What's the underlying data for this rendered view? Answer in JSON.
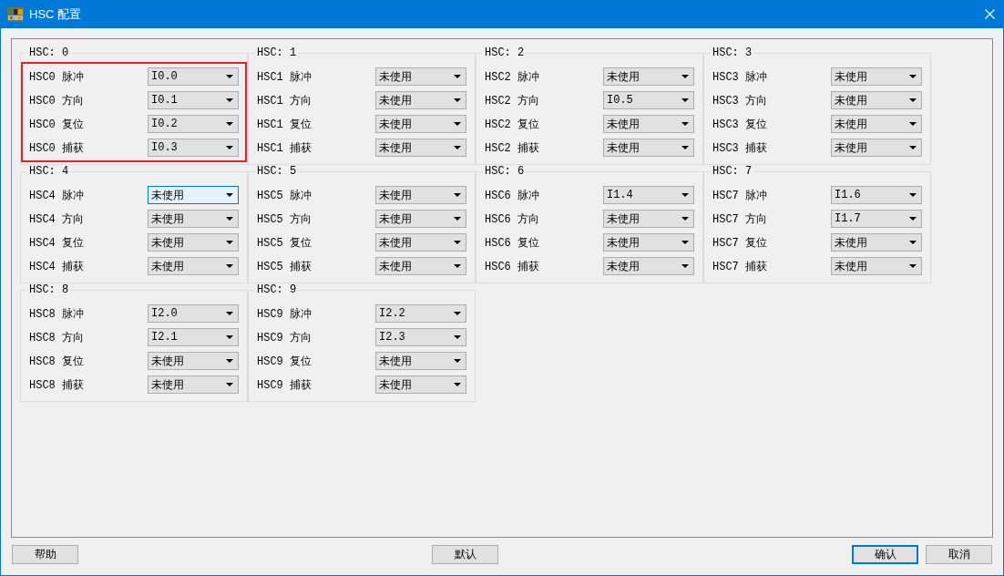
{
  "window": {
    "title": "HSC 配置"
  },
  "groups": [
    {
      "title": "HSC: 0",
      "highlighted": true,
      "fields": [
        {
          "label": "HSC0 脉冲",
          "value": "I0.0",
          "focused": false
        },
        {
          "label": "HSC0 方向",
          "value": "I0.1",
          "focused": false
        },
        {
          "label": "HSC0 复位",
          "value": "I0.2",
          "focused": false
        },
        {
          "label": "HSC0 捕获",
          "value": "I0.3",
          "focused": false
        }
      ]
    },
    {
      "title": "HSC: 1",
      "highlighted": false,
      "fields": [
        {
          "label": "HSC1 脉冲",
          "value": "未使用",
          "focused": false
        },
        {
          "label": "HSC1 方向",
          "value": "未使用",
          "focused": false
        },
        {
          "label": "HSC1 复位",
          "value": "未使用",
          "focused": false
        },
        {
          "label": "HSC1 捕获",
          "value": "未使用",
          "focused": false
        }
      ]
    },
    {
      "title": "HSC: 2",
      "highlighted": false,
      "fields": [
        {
          "label": "HSC2 脉冲",
          "value": "未使用",
          "focused": false
        },
        {
          "label": "HSC2 方向",
          "value": "I0.5",
          "focused": false
        },
        {
          "label": "HSC2 复位",
          "value": "未使用",
          "focused": false
        },
        {
          "label": "HSC2 捕获",
          "value": "未使用",
          "focused": false
        }
      ]
    },
    {
      "title": "HSC: 3",
      "highlighted": false,
      "fields": [
        {
          "label": "HSC3 脉冲",
          "value": "未使用",
          "focused": false
        },
        {
          "label": "HSC3 方向",
          "value": "未使用",
          "focused": false
        },
        {
          "label": "HSC3 复位",
          "value": "未使用",
          "focused": false
        },
        {
          "label": "HSC3 捕获",
          "value": "未使用",
          "focused": false
        }
      ]
    },
    {
      "title": "HSC: 4",
      "highlighted": false,
      "fields": [
        {
          "label": "HSC4 脉冲",
          "value": "未使用",
          "focused": true
        },
        {
          "label": "HSC4 方向",
          "value": "未使用",
          "focused": false
        },
        {
          "label": "HSC4 复位",
          "value": "未使用",
          "focused": false
        },
        {
          "label": "HSC4 捕获",
          "value": "未使用",
          "focused": false
        }
      ]
    },
    {
      "title": "HSC: 5",
      "highlighted": false,
      "fields": [
        {
          "label": "HSC5 脉冲",
          "value": "未使用",
          "focused": false
        },
        {
          "label": "HSC5 方向",
          "value": "未使用",
          "focused": false
        },
        {
          "label": "HSC5 复位",
          "value": "未使用",
          "focused": false
        },
        {
          "label": "HSC5 捕获",
          "value": "未使用",
          "focused": false
        }
      ]
    },
    {
      "title": "HSC: 6",
      "highlighted": false,
      "fields": [
        {
          "label": "HSC6 脉冲",
          "value": "I1.4",
          "focused": false
        },
        {
          "label": "HSC6 方向",
          "value": "未使用",
          "focused": false
        },
        {
          "label": "HSC6 复位",
          "value": "未使用",
          "focused": false
        },
        {
          "label": "HSC6 捕获",
          "value": "未使用",
          "focused": false
        }
      ]
    },
    {
      "title": "HSC: 7",
      "highlighted": false,
      "fields": [
        {
          "label": "HSC7 脉冲",
          "value": "I1.6",
          "focused": false
        },
        {
          "label": "HSC7 方向",
          "value": "I1.7",
          "focused": false
        },
        {
          "label": "HSC7 复位",
          "value": "未使用",
          "focused": false
        },
        {
          "label": "HSC7 捕获",
          "value": "未使用",
          "focused": false
        }
      ]
    },
    {
      "title": "HSC: 8",
      "highlighted": false,
      "fields": [
        {
          "label": "HSC8 脉冲",
          "value": "I2.0",
          "focused": false
        },
        {
          "label": "HSC8 方向",
          "value": "I2.1",
          "focused": false
        },
        {
          "label": "HSC8 复位",
          "value": "未使用",
          "focused": false
        },
        {
          "label": "HSC8 捕获",
          "value": "未使用",
          "focused": false
        }
      ]
    },
    {
      "title": "HSC: 9",
      "highlighted": false,
      "fields": [
        {
          "label": "HSC9 脉冲",
          "value": "I2.2",
          "focused": false
        },
        {
          "label": "HSC9 方向",
          "value": "I2.3",
          "focused": false
        },
        {
          "label": "HSC9 复位",
          "value": "未使用",
          "focused": false
        },
        {
          "label": "HSC9 捕获",
          "value": "未使用",
          "focused": false
        }
      ]
    }
  ],
  "footer": {
    "left_buttons": [
      {
        "label": "帮助",
        "default": false
      }
    ],
    "center_buttons": [
      {
        "label": "默认",
        "default": false
      }
    ],
    "right_buttons": [
      {
        "label": "确认",
        "default": true
      },
      {
        "label": "取消",
        "default": false
      }
    ]
  }
}
